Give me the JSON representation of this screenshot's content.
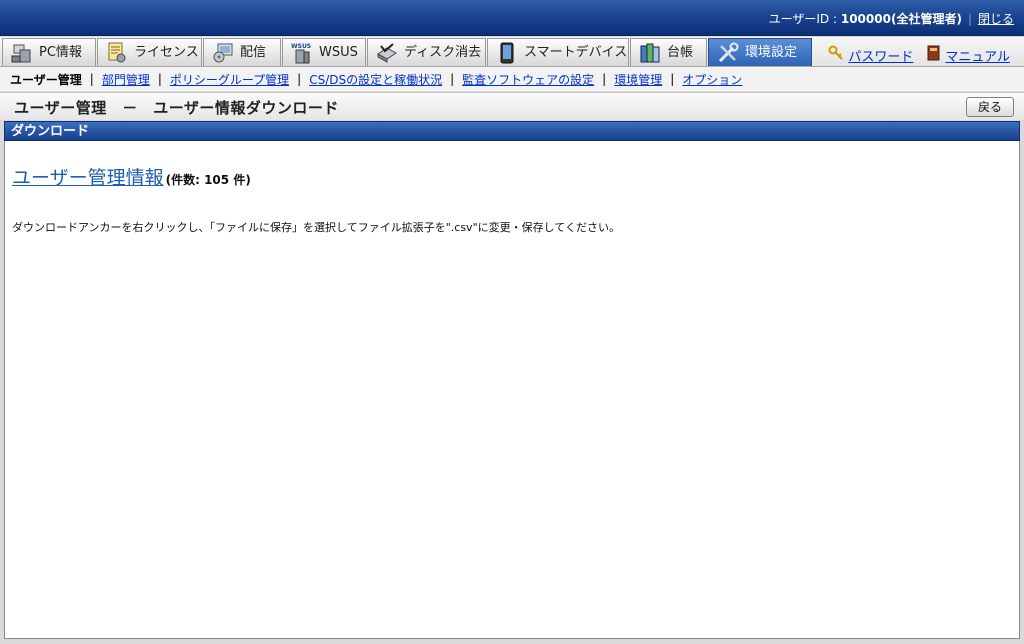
{
  "header": {
    "user_label": "ユーザーID : ",
    "user_id": "100000",
    "user_role": "(全社管理者)",
    "close_label": "閉じる"
  },
  "tabs": [
    {
      "label": "PC情報",
      "icon": "pc-icon"
    },
    {
      "label": "ライセンス",
      "icon": "license-icon"
    },
    {
      "label": "配信",
      "icon": "distribution-icon"
    },
    {
      "label": "WSUS",
      "icon": "wsus-icon"
    },
    {
      "label": "ディスク消去",
      "icon": "disk-erase-icon"
    },
    {
      "label": "スマートデバイス",
      "icon": "smart-device-icon"
    },
    {
      "label": "台帳",
      "icon": "ledger-icon"
    },
    {
      "label": "環境設定",
      "icon": "settings-tools-icon",
      "active": true
    }
  ],
  "top_links": {
    "password": "パスワード",
    "manual": "マニュアル"
  },
  "subnav": [
    "ユーザー管理",
    "部門管理",
    "ポリシーグループ管理",
    "CS/DSの設定と稼働状況",
    "監査ソフトウェアの設定",
    "環境管理",
    "オプション"
  ],
  "page": {
    "title": "ユーザー管理　－　ユーザー情報ダウンロード",
    "back_label": "戻る"
  },
  "section": {
    "header": "ダウンロード",
    "download_link": "ユーザー管理情報",
    "count_text": "(件数: 105 件)",
    "instruction": "ダウンロードアンカーを右クリックし、「ファイルに保存」を選択してファイル拡張子を\".csv\"に変更・保存してください。"
  },
  "colors": {
    "header_blue": "#1b4592",
    "active_tab": "#2e63b5",
    "link": "#0033cc"
  }
}
